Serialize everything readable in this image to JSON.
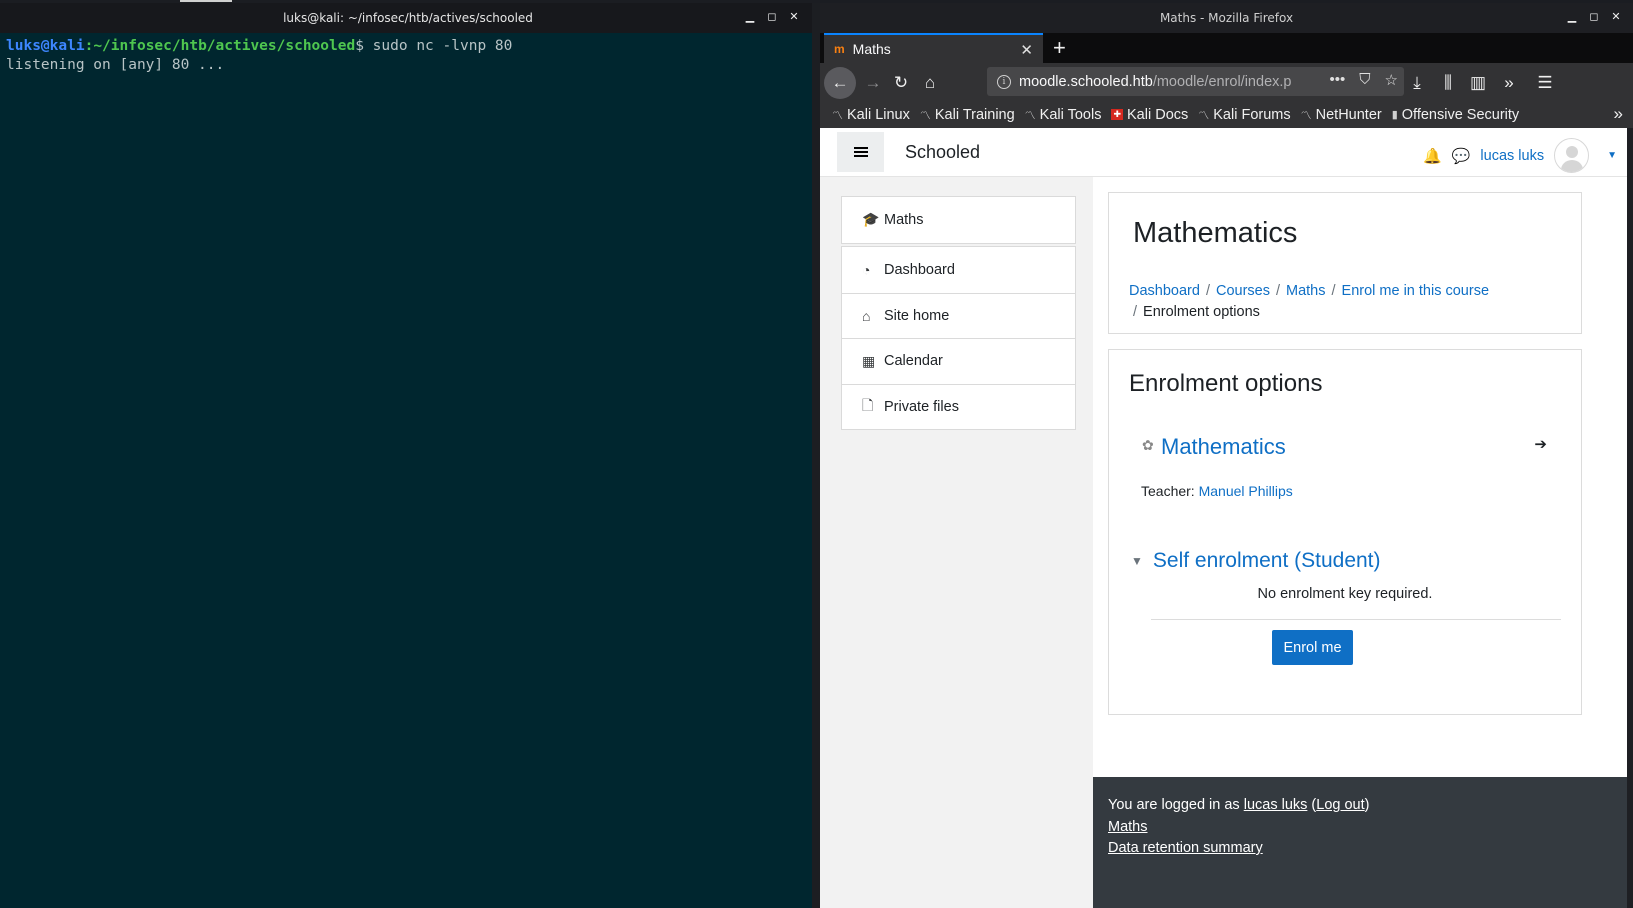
{
  "terminal": {
    "title": "luks@kali: ~/infosec/htb/actives/schooled",
    "prompt_user": "luks@kali",
    "prompt_sep": ":",
    "prompt_path": "~/infosec/htb/actives/schooled",
    "prompt_end": "$",
    "command": " sudo nc -lvnp 80",
    "output_line": "listening on [any] 80 ...",
    "win_minimize": "▁",
    "win_maximize": "◻",
    "win_close": "✕"
  },
  "browser": {
    "title": "Maths - Mozilla Firefox",
    "tab_label": "Maths",
    "tab_favicon": "m",
    "tab_close": "✕",
    "new_tab": "+",
    "url_host": "moodle.schooled.htb",
    "url_path": "/moodle/enrol/index.p",
    "url_scheme_prefix": "",
    "nav_icons": {
      "back": "←",
      "forward": "→",
      "reload": "↻",
      "home": "⌂",
      "more": "•••",
      "pocket": "⛉",
      "star": "☆",
      "download": "⤓",
      "library": "⫼",
      "sidebar": "▥",
      "overflow": "»",
      "menu": "☰"
    },
    "bookmarks": [
      {
        "label": "Kali Linux",
        "icon": "kali-dragon-icon"
      },
      {
        "label": "Kali Training",
        "icon": "kali-dragon-icon"
      },
      {
        "label": "Kali Tools",
        "icon": "kali-dragon-icon"
      },
      {
        "label": "Kali Docs",
        "icon": "kali-docs-icon"
      },
      {
        "label": "Kali Forums",
        "icon": "kali-dragon-icon"
      },
      {
        "label": "NetHunter",
        "icon": "nethunter-icon"
      },
      {
        "label": "Offensive Security",
        "icon": "offsec-icon"
      }
    ],
    "bookmarks_more": "»"
  },
  "moodle": {
    "site_name": "Schooled",
    "user_name": "lucas luks",
    "drawer": {
      "course": "Maths",
      "items": [
        "Dashboard",
        "Site home",
        "Calendar",
        "Private files"
      ]
    },
    "page_title": "Mathematics",
    "breadcrumb": [
      "Dashboard",
      "Courses",
      "Maths",
      "Enrol me in this course",
      "Enrolment options"
    ],
    "breadcrumb_sep": "/",
    "enrol": {
      "heading": "Enrolment options",
      "course_name": "Mathematics",
      "teacher_label": "Teacher: ",
      "teacher_name": "Manuel Phillips",
      "method": "Self enrolment (Student)",
      "no_key": "No enrolment key required.",
      "button": "Enrol me"
    },
    "footer": {
      "logged_in_prefix": "You are logged in as ",
      "user": "lucas luks",
      "open_paren": " (",
      "logout": "Log out",
      "close_paren": ")",
      "link_maths": "Maths",
      "link_data_retention": "Data retention summary"
    }
  },
  "colors": {
    "accent": "#0f6fc5",
    "terminal_bg": "#00262f",
    "footer_bg": "#343a40"
  }
}
